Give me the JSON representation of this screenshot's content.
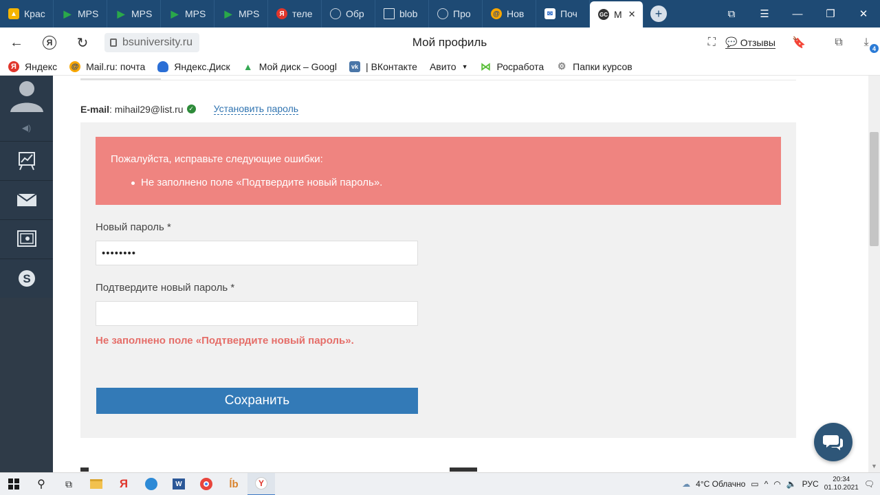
{
  "browser": {
    "tabs": [
      {
        "label": "Крас",
        "icon": "google-drive-icon",
        "color": "#f4b400"
      },
      {
        "label": "MPS",
        "icon": "play-icon",
        "color": "#2aa84a"
      },
      {
        "label": "MPS",
        "icon": "play-icon",
        "color": "#2aa84a"
      },
      {
        "label": "MPS",
        "icon": "play-icon",
        "color": "#2aa84a"
      },
      {
        "label": "MPS",
        "icon": "play-icon",
        "color": "#2aa84a"
      },
      {
        "label": "теле",
        "icon": "yandex-icon",
        "color": "#e0362c"
      },
      {
        "label": "Обр",
        "icon": "globe-icon",
        "color": "#555555"
      },
      {
        "label": "blob",
        "icon": "document-icon",
        "color": "#dddddd"
      },
      {
        "label": "Про",
        "icon": "globe-icon",
        "color": "#555555"
      },
      {
        "label": "Нов",
        "icon": "mailru-icon",
        "color": "#1a72d6"
      },
      {
        "label": "Поч",
        "icon": "mail-icon",
        "color": "#1a5fc4"
      },
      {
        "label": "М",
        "icon": "gc-icon",
        "color": "#333333"
      }
    ],
    "url": "bsuniversity.ru",
    "page_title": "Мой профиль",
    "reviews_label": "Отзывы",
    "downloads_count": "4",
    "bookmarks": [
      {
        "label": "Яндекс",
        "icon": "yandex-icon",
        "color": "#e0362c"
      },
      {
        "label": "Mail.ru: почта",
        "icon": "mailru-icon",
        "color": "#1a72d6"
      },
      {
        "label": "Яндекс.Диск",
        "icon": "yandex-disk-icon",
        "color": "#2b6fd6"
      },
      {
        "label": "Мой диск – Googl",
        "icon": "google-drive-icon",
        "color": "#34a853"
      },
      {
        "label": "| ВКонтакте",
        "icon": "vk-icon",
        "color": "#4a76a8"
      },
      {
        "label": "Авито",
        "icon": "",
        "color": ""
      },
      {
        "label": "Росработа",
        "icon": "rosrabota-icon",
        "color": "#5bbf3a"
      },
      {
        "label": "Папки курсов",
        "icon": "folder-gear-icon",
        "color": "#888888"
      }
    ]
  },
  "profile": {
    "email_label": "E-mail",
    "email_value": "mihail29@list.ru",
    "set_password_link": "Установить пароль"
  },
  "form": {
    "alert_title": "Пожалуйста, исправьте следующие ошибки:",
    "alert_items": [
      "Не заполнено поле «Подтвердите новый пароль»."
    ],
    "new_password_label": "Новый пароль *",
    "new_password_value": "••••••••",
    "confirm_password_label": "Подтвердите новый пароль *",
    "confirm_password_value": "",
    "confirm_error": "Не заполнено поле «Подтвердите новый пароль».",
    "save_label": "Сохранить"
  },
  "taskbar": {
    "weather": "4°C Облачно",
    "lang": "РУС",
    "time": "20:34",
    "date": "01.10.2021"
  },
  "colors": {
    "alert_bg": "#ef8480",
    "error_text": "#e56e69",
    "primary_button": "#337ab7",
    "link": "#2f73b0",
    "sidebar_bg": "#2b3a4a",
    "tabstrip_bg": "#1e4a74"
  }
}
